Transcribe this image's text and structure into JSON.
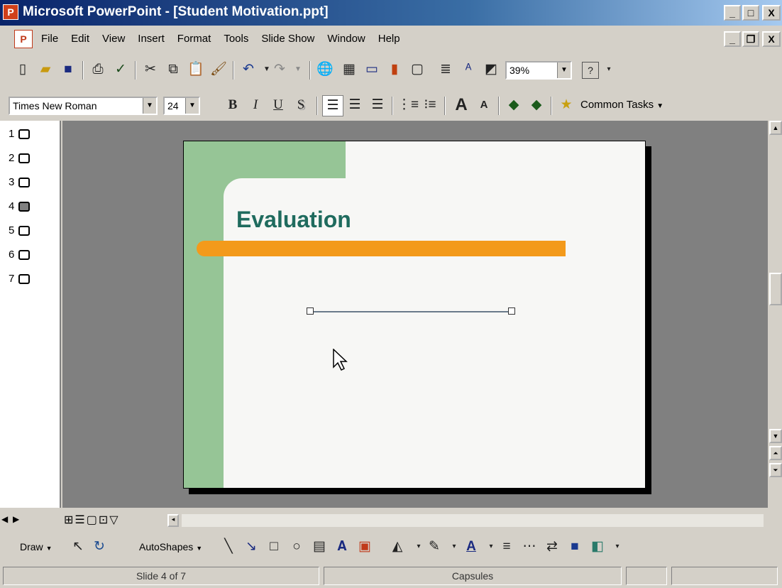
{
  "window": {
    "app_icon": "P",
    "title": "Microsoft PowerPoint - [Student Motivation.ppt]",
    "controls": [
      "_",
      "□",
      "X"
    ]
  },
  "menubar": {
    "doc_icon": "P",
    "items": [
      "File",
      "Edit",
      "View",
      "Insert",
      "Format",
      "Tools",
      "Slide Show",
      "Window",
      "Help"
    ],
    "doc_controls": [
      "_",
      "❐",
      "X"
    ]
  },
  "toolbar_standard": {
    "zoom": "39%",
    "help": "?"
  },
  "toolbar_formatting": {
    "font": "Times New Roman",
    "size": "24",
    "bold": "B",
    "italic": "I",
    "underline": "U",
    "shadow": "S",
    "grow": "A",
    "shrink": "A",
    "common_tasks": "Common Tasks"
  },
  "outline": {
    "slides": [
      "1",
      "2",
      "3",
      "4",
      "5",
      "6",
      "7"
    ],
    "active_index": 3
  },
  "slide": {
    "title": "Evaluation"
  },
  "drawbar": {
    "draw": "Draw",
    "autoshapes": "AutoShapes"
  },
  "status": {
    "slide": "Slide 4 of 7",
    "design": "Capsules"
  },
  "colors": {
    "title_teal": "#1f6b5e",
    "accent_orange": "#f39a1b",
    "sidebar_green": "#96c596"
  }
}
